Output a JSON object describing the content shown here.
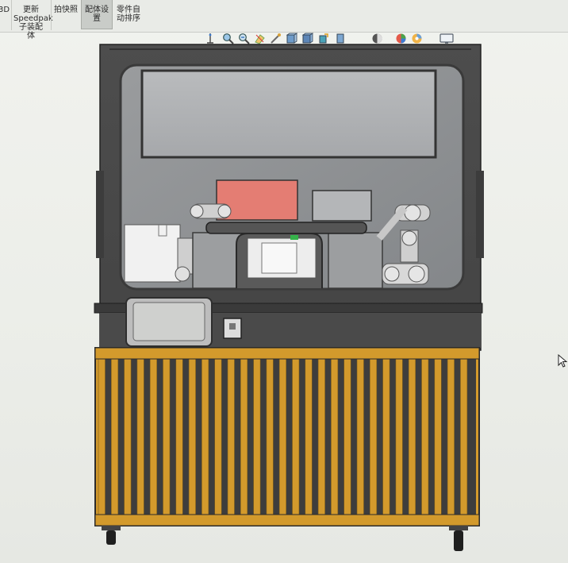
{
  "ribbon": {
    "items": [
      {
        "id": "partial-left",
        "label": "3D"
      },
      {
        "id": "update-speedpak",
        "label": "更新\nSpeedpak\n子装配\n体"
      },
      {
        "id": "take-snapshot",
        "label": "拍快照"
      },
      {
        "id": "assembly-settings",
        "label": "配体设\n置"
      },
      {
        "id": "auto-sort",
        "label": "零件自\n动排序"
      }
    ]
  },
  "view_toolbar": {
    "icons": [
      "zoom-to-fit-icon",
      "zoom-area-icon",
      "previous-view-icon",
      "section-view-icon",
      "dynamic-annotation-icon",
      "view-orientation-icon",
      "display-style-icon",
      "hide-show-items-icon",
      "edit-appearance-icon",
      "apply-scene-icon",
      "view-settings-icon",
      "display-monitor-icon"
    ]
  },
  "model": {
    "frame_color": "#4a4a4a",
    "glass_color": "#8f9193",
    "door_color": "#d39a2c",
    "accent_screen_color": "#e27e74"
  }
}
